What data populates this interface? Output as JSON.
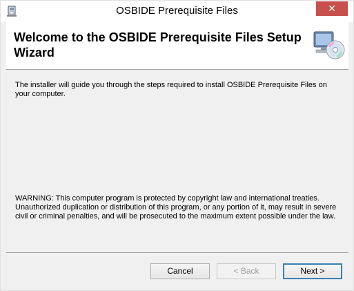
{
  "window": {
    "title": "OSBIDE Prerequisite Files",
    "close_glyph": "✕",
    "app_icon": "installer-icon"
  },
  "banner": {
    "heading": "Welcome to the OSBIDE Prerequisite Files Setup Wizard",
    "icon": "computer-cd-icon"
  },
  "content": {
    "intro": "The installer will guide you through the steps required to install OSBIDE Prerequisite Files on your computer.",
    "warning": "WARNING: This computer program is protected by copyright law and international treaties. Unauthorized duplication or distribution of this program, or any portion of it, may result in severe civil or criminal penalties, and will be prosecuted to the maximum extent possible under the law."
  },
  "buttons": {
    "cancel": "Cancel",
    "back": "< Back",
    "next": "Next >"
  },
  "colors": {
    "close_button": "#c7504d",
    "default_button_border": "#3c7fb1",
    "background": "#f0f0f0"
  }
}
